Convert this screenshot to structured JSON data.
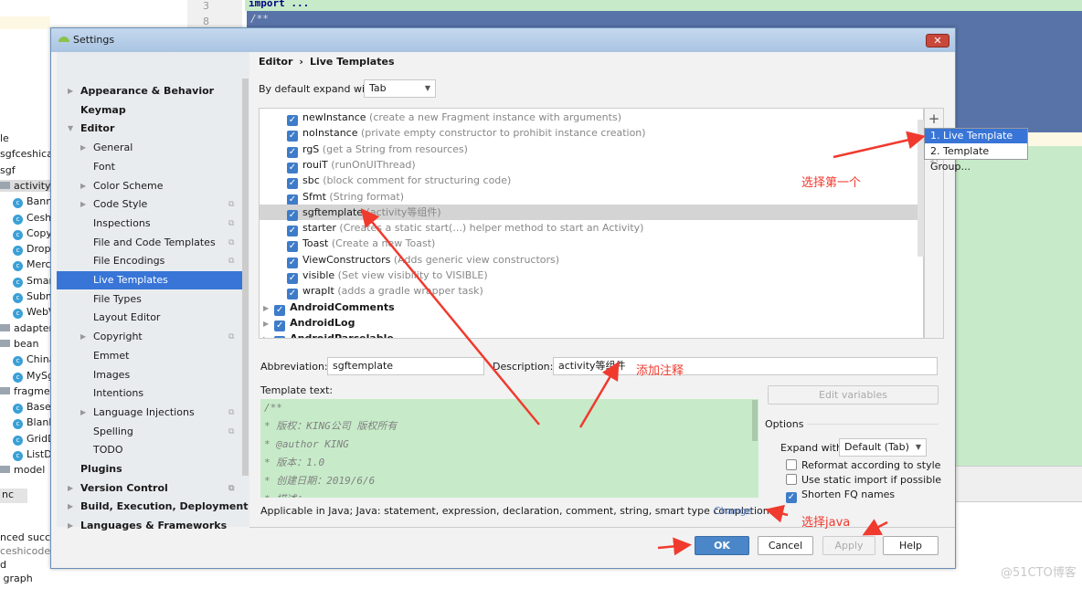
{
  "ide": {
    "line_numbers": [
      "3",
      "8"
    ],
    "code_lines": [
      "import ...",
      "/**"
    ],
    "tree": [
      {
        "label": "le",
        "kind": "text"
      },
      {
        "label": "sgfceshicase",
        "kind": "text"
      },
      {
        "label": "sgf",
        "kind": "text"
      },
      {
        "label": "activity",
        "kind": "folder"
      },
      {
        "label": "Banne",
        "kind": "class"
      },
      {
        "label": "Ceshi",
        "kind": "class"
      },
      {
        "label": "Copy",
        "kind": "class"
      },
      {
        "label": "Dropl",
        "kind": "class"
      },
      {
        "label": "Merc",
        "kind": "class"
      },
      {
        "label": "Smart",
        "kind": "class"
      },
      {
        "label": "Subm",
        "kind": "class"
      },
      {
        "label": "WebV",
        "kind": "class"
      },
      {
        "label": "adapter",
        "kind": "folder"
      },
      {
        "label": "bean",
        "kind": "folder"
      },
      {
        "label": "China",
        "kind": "class"
      },
      {
        "label": "MySg",
        "kind": "class"
      },
      {
        "label": "fragment",
        "kind": "folder"
      },
      {
        "label": "BaseF",
        "kind": "class"
      },
      {
        "label": "Blank",
        "kind": "class"
      },
      {
        "label": "GridD",
        "kind": "class"
      },
      {
        "label": "ListDe",
        "kind": "class"
      },
      {
        "label": "model",
        "kind": "folder"
      }
    ],
    "bottom_tab": "nc",
    "log": [
      "nced succe",
      "ceshicode",
      "",
      "d",
      " graph"
    ]
  },
  "dialog": {
    "title": "Settings",
    "search_placeholder": "",
    "sidebar": [
      {
        "label": "Appearance & Behavior",
        "bold": true,
        "arrow": true,
        "indent": 0
      },
      {
        "label": "Keymap",
        "bold": true,
        "indent": 0
      },
      {
        "label": "Editor",
        "bold": true,
        "expanded": true,
        "indent": 0
      },
      {
        "label": "General",
        "arrow": true,
        "indent": 1
      },
      {
        "label": "Font",
        "indent": 1
      },
      {
        "label": "Color Scheme",
        "arrow": true,
        "indent": 1
      },
      {
        "label": "Code Style",
        "arrow": true,
        "indent": 1,
        "project": true
      },
      {
        "label": "Inspections",
        "indent": 1,
        "project": true
      },
      {
        "label": "File and Code Templates",
        "indent": 1,
        "project": true
      },
      {
        "label": "File Encodings",
        "indent": 1,
        "project": true
      },
      {
        "label": "Live Templates",
        "indent": 1,
        "selected": true
      },
      {
        "label": "File Types",
        "indent": 1
      },
      {
        "label": "Layout Editor",
        "indent": 1
      },
      {
        "label": "Copyright",
        "arrow": true,
        "indent": 1,
        "project": true
      },
      {
        "label": "Emmet",
        "indent": 1
      },
      {
        "label": "Images",
        "indent": 1
      },
      {
        "label": "Intentions",
        "indent": 1
      },
      {
        "label": "Language Injections",
        "arrow": true,
        "indent": 1,
        "project": true
      },
      {
        "label": "Spelling",
        "indent": 1,
        "project": true
      },
      {
        "label": "TODO",
        "indent": 1
      },
      {
        "label": "Plugins",
        "bold": true,
        "indent": 0
      },
      {
        "label": "Version Control",
        "bold": true,
        "arrow": true,
        "indent": 0,
        "project": true
      },
      {
        "label": "Build, Execution, Deployment",
        "bold": true,
        "arrow": true,
        "indent": 0
      },
      {
        "label": "Languages & Frameworks",
        "bold": true,
        "arrow": true,
        "indent": 0
      }
    ],
    "breadcrumb": [
      "Editor",
      "Live Templates"
    ],
    "expand_label": "By default expand with",
    "expand_value": "Tab",
    "templates": [
      {
        "name": "newInstance",
        "desc": "(create a new Fragment instance with arguments)"
      },
      {
        "name": "noInstance",
        "desc": "(private empty constructor to prohibit instance creation)"
      },
      {
        "name": "rgS",
        "desc": "(get a String from resources)"
      },
      {
        "name": "rouiT",
        "desc": "(runOnUIThread)"
      },
      {
        "name": "sbc",
        "desc": "(block comment for structuring code)"
      },
      {
        "name": "Sfmt",
        "desc": "(String format)"
      },
      {
        "name": "sgftemplate",
        "desc": "(activity等组件)",
        "selected": true
      },
      {
        "name": "starter",
        "desc": "(Creates a static start(...) helper method to start an Activity)"
      },
      {
        "name": "Toast",
        "desc": "(Create a new Toast)"
      },
      {
        "name": "ViewConstructors",
        "desc": "(Adds generic view constructors)"
      },
      {
        "name": "visible",
        "desc": "(Set view visibility to VISIBLE)"
      },
      {
        "name": "wrapIt",
        "desc": "(adds a gradle wrapper task)"
      }
    ],
    "groups": [
      "AndroidComments",
      "AndroidLog",
      "AndroidParcelable"
    ],
    "add_menu": [
      "1. Live Template",
      "2. Template Group..."
    ],
    "abbreviation_label": "Abbreviation:",
    "abbreviation": "sgftemplate",
    "description_label": "Description:",
    "description": "activity等组件",
    "template_text_label": "Template text:",
    "template_text": [
      "/**",
      "* 版权：KING公司 版权所有",
      "* @author KING",
      "* 版本：1.0",
      "* 创建日期：2019/6/6",
      "* 描述：..."
    ],
    "edit_variables": "Edit variables",
    "options_label": "Options",
    "expand_with_label": "Expand with",
    "expand_with_value": "Default (Tab)",
    "options": [
      {
        "label": "Reformat according to style",
        "checked": false
      },
      {
        "label": "Use static import if possible",
        "checked": false
      },
      {
        "label": "Shorten FQ names",
        "checked": true
      }
    ],
    "applicable": "Applicable in Java; Java: statement, expression, declaration, comment, string, smart type completion...",
    "change": "Change",
    "buttons": {
      "ok": "OK",
      "cancel": "Cancel",
      "apply": "Apply",
      "help": "Help"
    }
  },
  "annotations": {
    "pick_first": "选择第一个",
    "add_comment": "添加注释",
    "pick_java": "选择java",
    "color": "#f03a2e"
  },
  "watermark": "@51CTO博客",
  "colors": {
    "accent": "#3875d7",
    "template_bg": "#c7ebc9",
    "editor_selection": "#5873a8"
  }
}
